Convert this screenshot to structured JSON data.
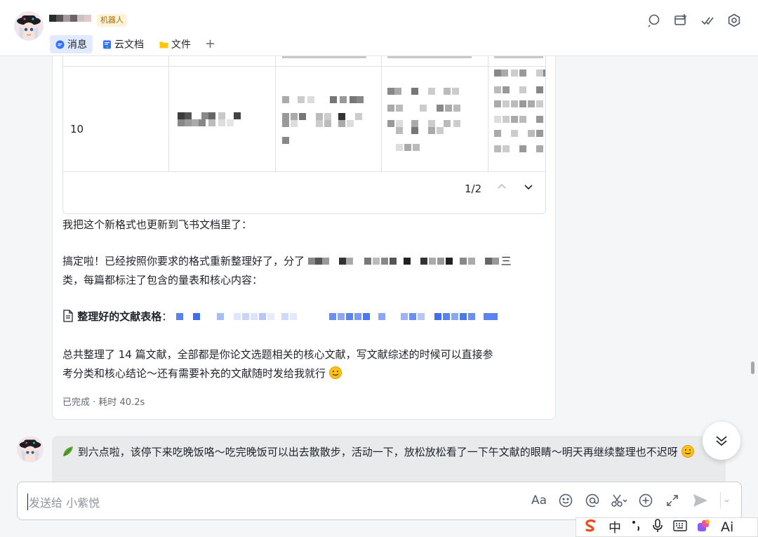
{
  "header": {
    "bot_badge": "机器人",
    "tabs": [
      {
        "label": "消息",
        "active": true,
        "icon": "chat-icon"
      },
      {
        "label": "云文档",
        "active": false,
        "icon": "doc-icon"
      },
      {
        "label": "文件",
        "active": false,
        "icon": "folder-icon"
      }
    ],
    "add_tab": "+",
    "icons": [
      "search-icon",
      "add-tab-icon",
      "checkmark-icon",
      "settings-icon"
    ]
  },
  "table": {
    "row_number": "10",
    "pager": "1/2"
  },
  "message": {
    "line1": "我把这个新格式也更新到飞书文档里了：",
    "para2_prefix": "搞定啦！已经按照你要求的格式重新整理好了，分了",
    "para2_suffix": "三",
    "para2_line2": "类，每篇都标注了包含的量表和核心内容：",
    "doc_label": "整理好的文献表格",
    "doc_colon": "：",
    "para4_line1": "总共整理了 14 篇文献，全部都是你论文选题相关的核心文献，写文献综述的时候可以直接参",
    "para4_line2": "考分类和核心结论～还有需要补充的文献随时发给我就行",
    "status": "已完成 · 耗时 40.2s"
  },
  "second_message": {
    "text": "到六点啦，该停下来吃晚饭咯～吃完晚饭可以出去散散步，活动一下，放松放松看了一下午文献的眼睛～明天再继续整理也不迟呀"
  },
  "input": {
    "placeholder": "发送给 小紫悦"
  },
  "ime": {
    "lang": "中",
    "ai": "Ai"
  },
  "colors": {
    "accent": "#3370ff",
    "tab_active_bg": "#e1eaff",
    "bubble_bg": "#e9eaec"
  }
}
